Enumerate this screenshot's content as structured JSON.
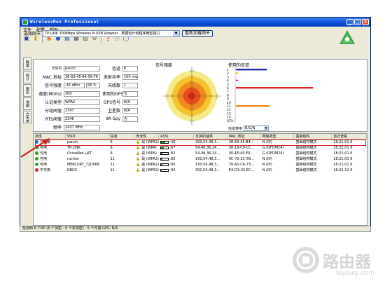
{
  "window": {
    "title": "WirelessMon Professional",
    "controls": [
      "_",
      "□",
      "×"
    ]
  },
  "menu": [
    "文件",
    "配置",
    "帮助"
  ],
  "toolbar": {
    "icons": [
      "save-icon",
      "open-folder-icon",
      "start-icon",
      "stop-icon",
      "export-icon",
      "print-icon",
      "log-icon",
      "settings-icon",
      "help-icon",
      "about-icon",
      "info-icon"
    ]
  },
  "adapter": {
    "label": "选择网卡",
    "value": "TP-LINK 300Mbps Wireless N USB Adapter - 数据包计划程序微型端口",
    "reload_button": "重新加载网卡"
  },
  "tabs": [
    "概要",
    "统计",
    "图形",
    "地图",
    "白名单"
  ],
  "info": {
    "ssid_label": "SSID",
    "ssid": "panch",
    "channel_label": "信道",
    "channel": "6",
    "mac_label": "MAC 地址",
    "mac": "38-83-45-B4-56-F6",
    "txpower_label": "发射功率",
    "txpower": "100 mw",
    "rssi_label": "信号强度",
    "rssi": "-45 dBm",
    "rssi_percent": "58 %",
    "antenna_label": "天线数",
    "antenna": "1",
    "rate_label": "速度(Mbits)",
    "rate": "300",
    "gps_label": "使用的GPS",
    "gps": "否",
    "auth_label": "认证类型",
    "auth": "WPA2",
    "gps_signal_label": "GPS信号",
    "gps_signal": "N/A",
    "cipher_label": "分组阀值",
    "cipher": "2347",
    "satellites_label": "卫星数",
    "satellites": "N/A",
    "rts_label": "RTS阀值",
    "rts": "2346",
    "wispy_label": "Wi-Spy",
    "wispy": "否",
    "freq_label": "频率",
    "freq": "2437 MHz"
  },
  "radar": {
    "title": "信号强度",
    "ring_colors": [
      "#f6e98a",
      "#f4c430",
      "#f08a1e",
      "#e74c1c",
      "#d62012"
    ]
  },
  "channels": {
    "title": "使用的信道",
    "axis_labels": [
      "1",
      "2",
      "3",
      "4",
      "5",
      "6",
      "7",
      "8",
      "9",
      "10",
      "11",
      "12",
      "13",
      "14",
      "OTH"
    ],
    "select_label": "信道使用",
    "select_value": "B/G/N",
    "bars": [
      {
        "channel": 1,
        "fraction": 0.24,
        "color": "#1f2ba8"
      },
      {
        "channel": 6,
        "fraction": 0.6,
        "color": "#e32521"
      },
      {
        "channel": 11,
        "fraction": 0.26,
        "color": "#ef8a1a"
      }
    ],
    "marks": [
      {
        "channel": 2,
        "color": "#f0d000"
      },
      {
        "channel": 4,
        "color": "#d22ad0"
      }
    ]
  },
  "table": {
    "headers": [
      "状态",
      "SSID",
      "信道",
      "安全性",
      "RSSI",
      "支持的速率",
      "MAC 地址",
      "网络类型",
      "基础结构",
      "首次查看"
    ],
    "rows": [
      {
        "status": "已连接",
        "dot": "#3b6fd8",
        "ssid": "panch",
        "channel": "6",
        "security": "是 (WPA2)",
        "rssi": "-45",
        "fill": 0.58,
        "rates": "300,54,48,3...",
        "mac": "38-83-45-B4...",
        "net": "N (0f)",
        "infra": "基础结构模式",
        "first": "18:21:01 6"
      },
      {
        "status": "可用",
        "dot": "#2aa52a",
        "ssid": "TP-LINK",
        "channel": "6",
        "security": "是 (WPA)",
        "rssi": "-67",
        "fill": 0.38,
        "rates": "54,48,36,24...",
        "mac": "00-19-C0-CC...",
        "net": "G (OFDM24)",
        "infra": "基础结构模式",
        "first": "18:21:01 6"
      },
      {
        "status": "可用",
        "dot": "#2aa52a",
        "ssid": "ChinaNet-LJ4T",
        "channel": "6",
        "security": "是 (WPA)",
        "rssi": "-82",
        "fill": 0.2,
        "rates": "54,48,36,24...",
        "mac": "00-1E-40-F0...",
        "net": "G (OFDM24)",
        "infra": "基础结构模式",
        "first": "18:21:01 6"
      },
      {
        "status": "可用",
        "dot": "#2aa52a",
        "ssid": "ruchen",
        "channel": "11",
        "security": "是 (WPA2)",
        "rssi": "-82",
        "fill": 0.2,
        "rates": "150,54,48,3...",
        "mac": "0C-72-2C-59...",
        "net": "N (0f)",
        "infra": "基础结构模式",
        "first": "18:21:01 6"
      },
      {
        "status": "可用",
        "dot": "#2aa52a",
        "ssid": "MERCURY_72D068",
        "channel": "11",
        "security": "是 (WPA2)",
        "rssi": "-80",
        "fill": 0.22,
        "rates": "150,54,48,3...",
        "mac": "70-A1-C6-73...",
        "net": "N (0f)",
        "infra": "基础结构模式",
        "first": "18:21:01 6"
      },
      {
        "status": "不可用",
        "dot": "#d22020",
        "ssid": "DBGX",
        "channel": "11",
        "security": "是 (WPA2)",
        "rssi": "-92",
        "fill": 0.05,
        "rates": "300,54,48,3...",
        "mac": "E4-D3-32-EC...",
        "net": "N (0f)",
        "infra": "基础结构模式",
        "first": "18:21:12 6"
      }
    ]
  },
  "status_bar": "检测到 6 个AP (6 个加密 - 0 个未加密) - 5 个可用    GPS: N/A",
  "watermark": {
    "text": "路由器",
    "sub": "luyouqi.com"
  }
}
